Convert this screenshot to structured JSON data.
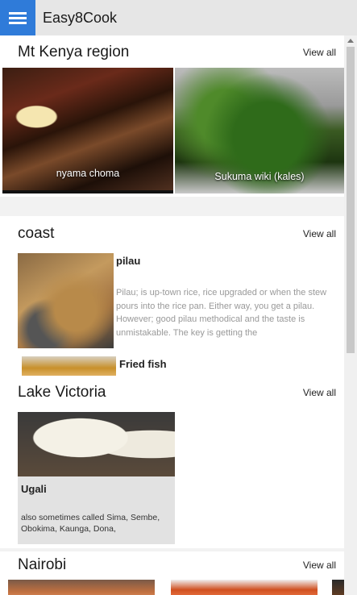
{
  "header": {
    "app_title": "Easy8Cook",
    "menu_icon": "hamburger-icon",
    "accent_color": "#2f7bd9"
  },
  "sections": [
    {
      "title": "Mt Kenya region",
      "view_all": "View all",
      "items": [
        {
          "caption": "nyama choma"
        },
        {
          "caption": "Sukuma wiki (kales)"
        }
      ]
    },
    {
      "title": "coast",
      "view_all": "View all",
      "items": [
        {
          "name": "pilau",
          "description": "Pilau; is up-town rice, rice upgraded or when the stew pours into the rice pan. Either way, you get a pilau. However; good pilau methodical and the taste is unmistakable. The key is getting the"
        },
        {
          "name": "Fried fish"
        }
      ]
    },
    {
      "title": "Lake Victoria",
      "view_all": "View all",
      "items": [
        {
          "name": "Ugali",
          "description": "also sometimes called Sima, Sembe, Obokima, Kaunga, Dona,"
        }
      ]
    },
    {
      "title": "Nairobi",
      "view_all": "View all"
    }
  ]
}
